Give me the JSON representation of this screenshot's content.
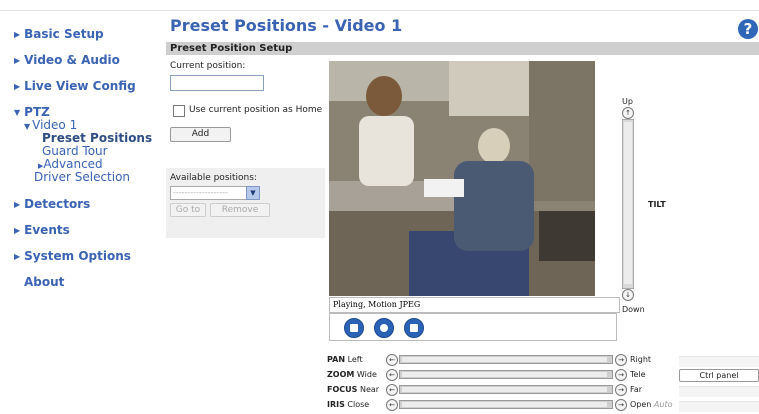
{
  "header": {
    "title": "Preset Positions - Video 1",
    "help_icon": "?"
  },
  "sidebar": {
    "items": [
      {
        "label": "Basic Setup"
      },
      {
        "label": "Video & Audio"
      },
      {
        "label": "Live View Config"
      },
      {
        "label": "PTZ"
      },
      {
        "label": "Detectors"
      },
      {
        "label": "Events"
      },
      {
        "label": "System Options"
      },
      {
        "label": "About"
      }
    ],
    "ptz_sub": {
      "video": "Video 1",
      "preset": "Preset Positions",
      "guard": "Guard Tour",
      "advanced": "Advanced",
      "driver": "Driver Selection"
    }
  },
  "setup": {
    "section_title": "Preset Position Setup",
    "current_label": "Current position:",
    "current_value": "",
    "home_checkbox_label": "Use current position as Home",
    "add_button": "Add",
    "available_label": "Available positions:",
    "available_selected": "-------------------",
    "goto_button": "Go to",
    "remove_button": "Remove"
  },
  "video": {
    "status": "Playing, Motion JPEG"
  },
  "tilt": {
    "up": "Up",
    "down": "Down",
    "label": "TILT"
  },
  "controls": [
    {
      "name": "PAN",
      "left": "Left",
      "right": "Right"
    },
    {
      "name": "ZOOM",
      "left": "Wide",
      "right": "Tele"
    },
    {
      "name": "FOCUS",
      "left": "Near",
      "right": "Far"
    },
    {
      "name": "IRIS",
      "left": "Close",
      "right": "Open",
      "extra": "Auto"
    }
  ],
  "ctrl_panel_button": "Ctrl panel",
  "colors": {
    "link": "#3a63b3",
    "section_bar": "#cfcfcf",
    "accent": "#2a63b6"
  }
}
